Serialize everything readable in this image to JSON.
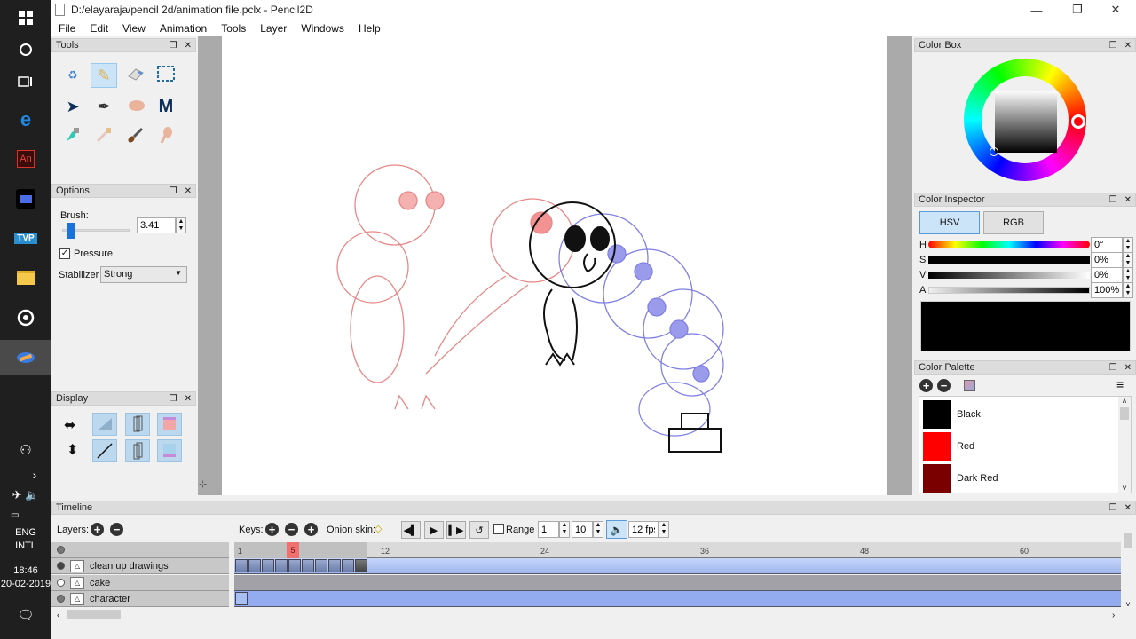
{
  "taskbar": {
    "icons": [
      "windows-start",
      "cortana",
      "task-view",
      "edge",
      "animate",
      "video-editor",
      "tvpaint",
      "file-explorer",
      "groove-music",
      "pencil2d"
    ],
    "clock_time": "18:46",
    "clock_date": "20-02-2019",
    "lang_1": "ENG",
    "lang_2": "INTL"
  },
  "window": {
    "title": "D:/elayaraja/pencil 2d/animation file.pclx - Pencil2D",
    "minimize": "—",
    "maximize": "❐",
    "close": "✕"
  },
  "menu": [
    "File",
    "Edit",
    "View",
    "Animation",
    "Tools",
    "Layer",
    "Windows",
    "Help"
  ],
  "tools_panel": {
    "title": "Tools",
    "tools": [
      "clear",
      "pencil",
      "eraser",
      "select",
      "move",
      "pen",
      "hand",
      "polyline",
      "bucket",
      "eyedropper",
      "brush",
      "smudge"
    ],
    "selected": "pencil"
  },
  "options_panel": {
    "title": "Options",
    "brush_label": "Brush:",
    "brush_value": "3.41",
    "pressure_label": "Pressure",
    "pressure_checked": true,
    "stabilizer_label": "Stabilizer",
    "stabilizer_value": "Strong"
  },
  "display_panel": {
    "title": "Display",
    "buttons": [
      "flip-horizontal",
      "flip-vertical",
      "outlines",
      "onion-prev",
      "onion-next",
      "onion-red",
      "thin-lines",
      "onion-blue"
    ]
  },
  "color_box": {
    "title": "Color Box",
    "hue_deg": 0,
    "saturation": 0,
    "value": 0
  },
  "color_inspector": {
    "title": "Color Inspector",
    "tab_hsv": "HSV",
    "tab_rgb": "RGB",
    "active_tab": "HSV",
    "h_label": "H",
    "h_value": "0°",
    "s_label": "S",
    "s_value": "0%",
    "v_label": "V",
    "v_value": "0%",
    "a_label": "A",
    "a_value": "100%",
    "preview_color": "#000000"
  },
  "color_palette": {
    "title": "Color Palette",
    "colors": [
      {
        "name": "Black",
        "hex": "#000000"
      },
      {
        "name": "Red",
        "hex": "#ff0000"
      },
      {
        "name": "Dark Red",
        "hex": "#7a0000"
      }
    ]
  },
  "timeline": {
    "title": "Timeline",
    "layers_label": "Layers:",
    "keys_label": "Keys:",
    "onion_label": "Onion skin:",
    "range_label": "Range",
    "range_checked": false,
    "range_start": "1",
    "range_end": "10",
    "fps": "12 fps",
    "current_frame": "5",
    "ruler_labels": [
      "1",
      "12",
      "24",
      "36",
      "48",
      "60"
    ],
    "layers": [
      {
        "name": "clean up drawings",
        "visible": true,
        "keyframes": 10
      },
      {
        "name": "cake",
        "visible": false,
        "keyframes": 0
      },
      {
        "name": "character",
        "visible": true,
        "keyframes": 1
      }
    ]
  }
}
